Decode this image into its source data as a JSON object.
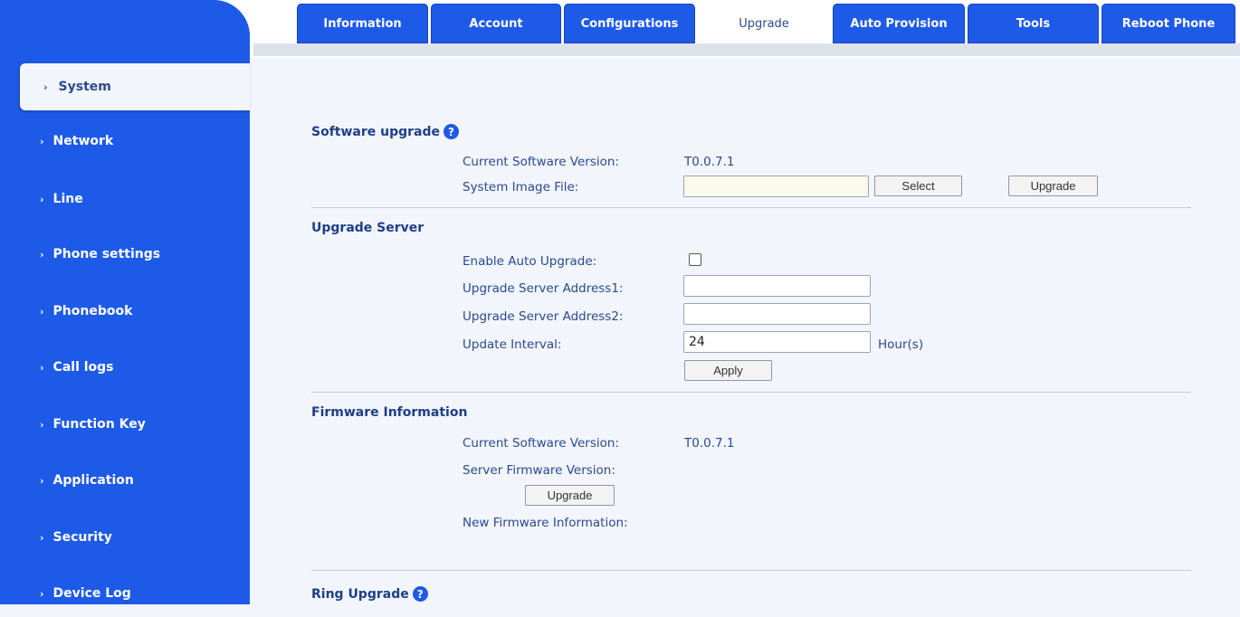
{
  "tabs": [
    "Information",
    "Account",
    "Configurations",
    "Upgrade",
    "Auto Provision",
    "Tools",
    "Reboot Phone"
  ],
  "active_tab": "Upgrade",
  "sidebar": {
    "items": [
      "System",
      "Network",
      "Line",
      "Phone settings",
      "Phonebook",
      "Call logs",
      "Function Key",
      "Application",
      "Security",
      "Device Log"
    ],
    "active": "System",
    "chevron": "›"
  },
  "software_upgrade": {
    "title": "Software upgrade",
    "current_version_label": "Current Software Version:",
    "current_version": "T0.0.7.1",
    "image_file_label": "System Image File:",
    "image_file_value": "",
    "select_button": "Select",
    "upgrade_button": "Upgrade"
  },
  "upgrade_server": {
    "title": "Upgrade Server",
    "auto_upgrade_label": "Enable Auto Upgrade:",
    "auto_upgrade_checked": false,
    "address1_label": "Upgrade Server Address1:",
    "address1_value": "",
    "address2_label": "Upgrade Server Address2:",
    "address2_value": "",
    "interval_label": "Update Interval:",
    "interval_value": "24",
    "interval_unit": "Hour(s)",
    "apply_button": "Apply"
  },
  "firmware_info": {
    "title": "Firmware Information",
    "current_version_label": "Current Software Version:",
    "current_version": "T0.0.7.1",
    "server_version_label": "Server Firmware Version:",
    "upgrade_button": "Upgrade",
    "new_info_label": "New Firmware Information:"
  },
  "ring_upgrade": {
    "title": "Ring Upgrade"
  },
  "help_icon": "?",
  "colors": {
    "primary": "#1d5ae8",
    "text": "#2a4a8f",
    "background": "#f2f5fb"
  }
}
